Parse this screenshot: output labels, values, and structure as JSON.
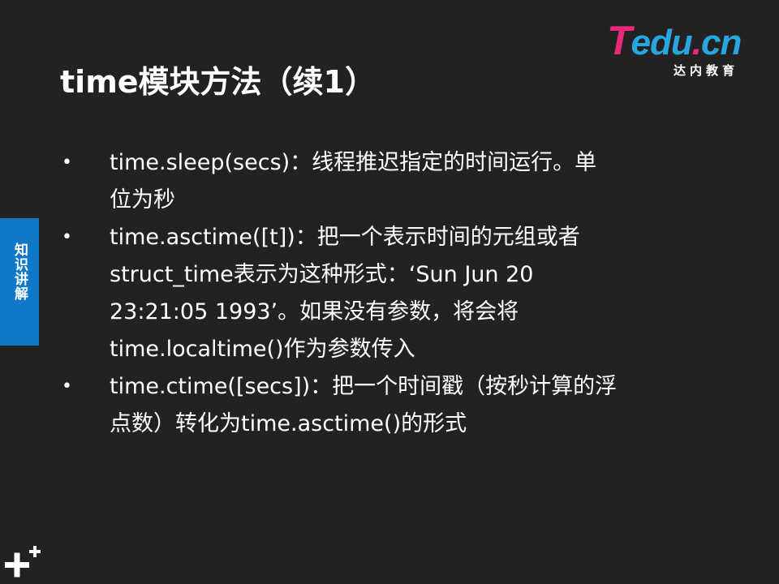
{
  "slide": {
    "title": "time模块方法（续1）"
  },
  "logo": {
    "mark_t": "T",
    "mark_rest": "edu",
    "mark_dot": ".",
    "mark_cn": "cn",
    "subtitle": "达内教育"
  },
  "side_tab": {
    "label": "知识讲解"
  },
  "bullets": [
    {
      "marker": "•",
      "text_lines": [
        "time.sleep(secs)：线程推迟指定的时间运行。单",
        "位为秒"
      ]
    },
    {
      "marker": "•",
      "text_lines": [
        "time.asctime([t])：把一个表示时间的元组或者",
        "struct_time表示为这种形式：‘Sun Jun 20",
        "23:21:05 1993’。如果没有参数，将会将",
        "time.localtime()作为参数传入"
      ]
    },
    {
      "marker": "•",
      "text_lines": [
        "time.ctime([secs])：把一个时间戳（按秒计算的浮",
        "点数）转化为time.asctime()的形式"
      ]
    }
  ],
  "colors": {
    "background": "#242122",
    "side_tab": "#0f78c8",
    "logo_pink": "#e8297a",
    "logo_blue": "#27a6e0"
  },
  "icons": {
    "corner": "plus-icon"
  }
}
